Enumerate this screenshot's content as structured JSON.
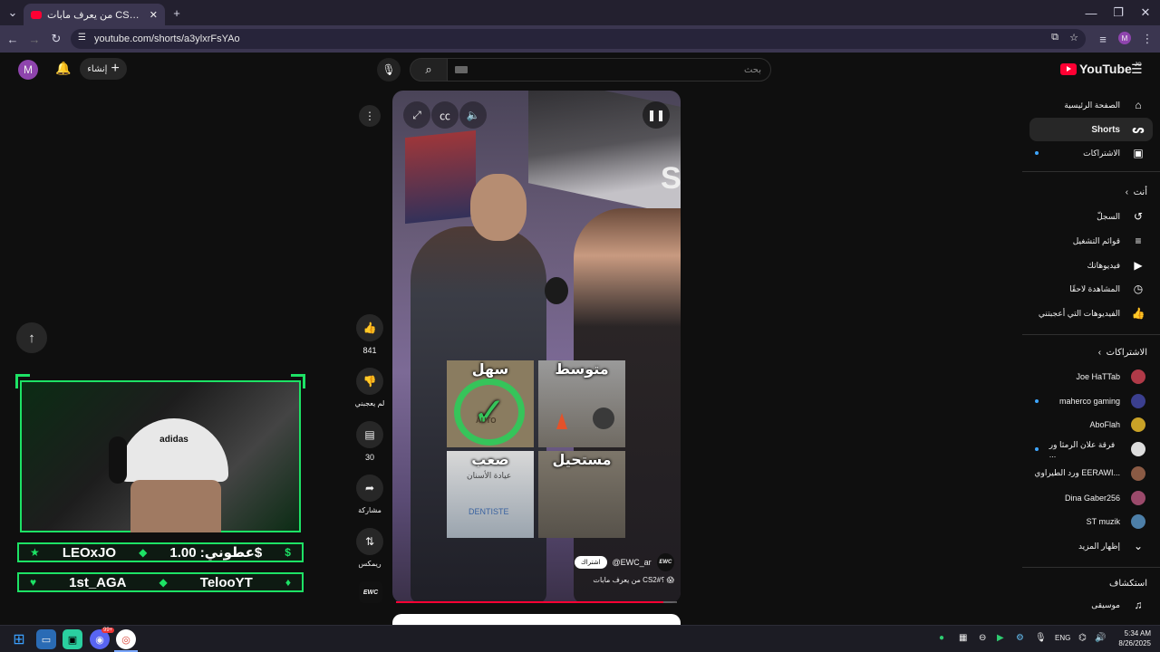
{
  "browser": {
    "tab_title": "من يعرف مابات CS2#؟ 😱 -",
    "url": "youtube.com/shorts/a3ylxrFsYAo",
    "profile_initial": "M"
  },
  "header": {
    "create_label": "إنشاء",
    "search_placeholder": "بحث",
    "logo_text": "YouTube",
    "logo_region": "JO",
    "avatar_initial": "M"
  },
  "sidebar": {
    "main": [
      {
        "label": "الصفحة الرئيسية",
        "icon": "home-icon"
      },
      {
        "label": "Shorts",
        "icon": "shorts-icon",
        "active": true
      },
      {
        "label": "الاشتراكات",
        "icon": "subscriptions-icon"
      }
    ],
    "you_heading": "أنت",
    "you": [
      {
        "label": "السجلّ",
        "icon": "history-icon"
      },
      {
        "label": "قوائم التشغيل",
        "icon": "playlists-icon"
      },
      {
        "label": "فيديوهاتك",
        "icon": "your-videos-icon"
      },
      {
        "label": "المشاهدة لاحقًا",
        "icon": "watch-later-icon"
      },
      {
        "label": "الفيديوهات التي أعجبتني",
        "icon": "liked-icon"
      }
    ],
    "subs_heading": "الاشتراكات",
    "subscriptions": [
      {
        "label": "Joe HaTTab",
        "color": "#b03a48",
        "dot": false
      },
      {
        "label": "maherco gaming",
        "color": "#3b3f8f",
        "dot": true
      },
      {
        "label": "AboFlah",
        "color": "#c9a227",
        "dot": false
      },
      {
        "label": "فرقة علان الرمثا ور ...",
        "color": "#dddddd",
        "dot": true
      },
      {
        "label": "ورد الطيراوي EERAWI...",
        "color": "#8a5a44",
        "dot": false
      },
      {
        "label": "Dina Gaber256",
        "color": "#9b4a6b",
        "dot": false
      },
      {
        "label": "ST muzik",
        "color": "#4d7fa8",
        "dot": false
      }
    ],
    "show_more": "إظهار المزيد",
    "explore_heading": "استكشاف",
    "explore": [
      {
        "label": "موسيقى",
        "icon": "music-icon"
      }
    ]
  },
  "short": {
    "grid": {
      "easy": "سهل",
      "medium": "متوسط",
      "hard": "صعب",
      "impossible": "مستحيل",
      "sign_text": "عيادة الأسنان",
      "sign_text_latin": "DENTISTE",
      "tile_text": "AUTO"
    },
    "corner_letter": "S",
    "channel": "@EWC_ar",
    "channel_badge": "EWC",
    "subscribe_label": "اشتراك",
    "caption": "من يعرف مابات CS2#؟ 😱",
    "progress": 0.95
  },
  "actions": {
    "likes": "841",
    "dislike_label": "لم يعجبني",
    "comments": "30",
    "share_label": "مشاركة",
    "remix_label": "ريمكس"
  },
  "overlay": {
    "cap_brand": "adidas",
    "row1_left": "LEOxJO",
    "row1_right": "عطوني: 1.00$",
    "row2_left": "1st_AGA",
    "row2_right": "TelooYT"
  },
  "taskbar": {
    "lang": "ENG",
    "time": "5:34 AM",
    "date": "8/26/2025",
    "discord_badge": "99+"
  }
}
